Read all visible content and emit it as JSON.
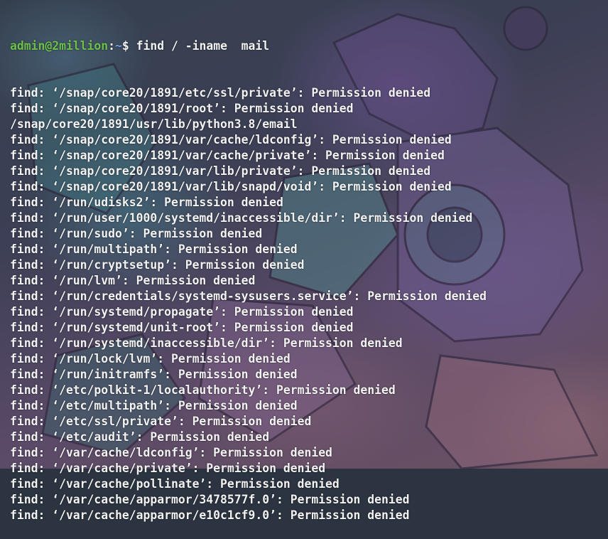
{
  "window": {
    "background_theme": "anime-mecha-wallpaper",
    "text_color": "#f2f2f2",
    "user_color": "#6cc04a",
    "path_color": "#6fa0e6"
  },
  "prompt": {
    "user_host": "admin@2million",
    "separator": ":",
    "cwd": "~",
    "symbol": "$",
    "command": "find / -iname  mail"
  },
  "output_lines": [
    "find: ‘/snap/core20/1891/etc/ssl/private’: Permission denied",
    "find: ‘/snap/core20/1891/root’: Permission denied",
    "/snap/core20/1891/usr/lib/python3.8/email",
    "find: ‘/snap/core20/1891/var/cache/ldconfig’: Permission denied",
    "find: ‘/snap/core20/1891/var/cache/private’: Permission denied",
    "find: ‘/snap/core20/1891/var/lib/private’: Permission denied",
    "find: ‘/snap/core20/1891/var/lib/snapd/void’: Permission denied",
    "find: ‘/run/udisks2’: Permission denied",
    "find: ‘/run/user/1000/systemd/inaccessible/dir’: Permission denied",
    "find: ‘/run/sudo’: Permission denied",
    "find: ‘/run/multipath’: Permission denied",
    "find: ‘/run/cryptsetup’: Permission denied",
    "find: ‘/run/lvm’: Permission denied",
    "find: ‘/run/credentials/systemd-sysusers.service’: Permission denied",
    "find: ‘/run/systemd/propagate’: Permission denied",
    "find: ‘/run/systemd/unit-root’: Permission denied",
    "find: ‘/run/systemd/inaccessible/dir’: Permission denied",
    "find: ‘/run/lock/lvm’: Permission denied",
    "find: ‘/run/initramfs’: Permission denied",
    "find: ‘/etc/polkit-1/localauthority’: Permission denied",
    "find: ‘/etc/multipath’: Permission denied",
    "find: ‘/etc/ssl/private’: Permission denied",
    "find: ‘/etc/audit’: Permission denied",
    "find: ‘/var/cache/ldconfig’: Permission denied",
    "find: ‘/var/cache/private’: Permission denied",
    "find: ‘/var/cache/pollinate’: Permission denied",
    "find: ‘/var/cache/apparmor/3478577f.0’: Permission denied",
    "find: ‘/var/cache/apparmor/e10c1cf9.0’: Permission denied"
  ]
}
